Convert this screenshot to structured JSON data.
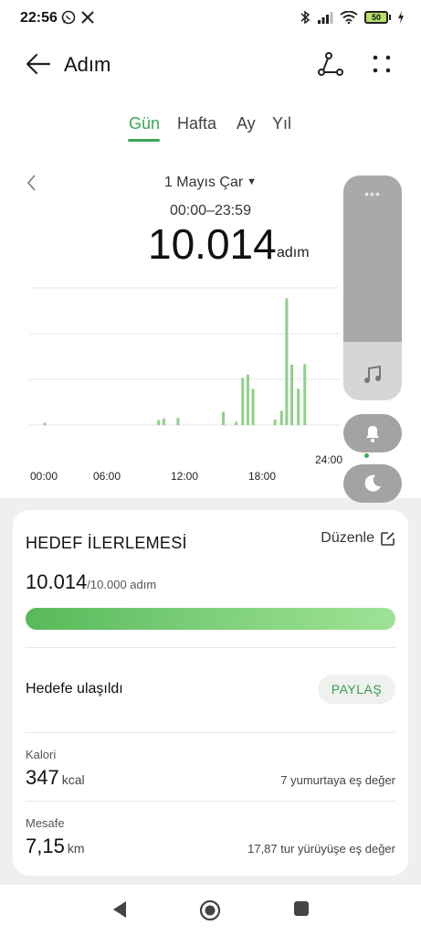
{
  "status_bar": {
    "time": "22:56",
    "battery": "50"
  },
  "app_bar": {
    "title": "Adım"
  },
  "tabs": [
    {
      "label": "Gün",
      "active": true
    },
    {
      "label": "Hafta",
      "active": false
    },
    {
      "label": "Ay",
      "active": false
    },
    {
      "label": "Yıl",
      "active": false
    }
  ],
  "day": {
    "date": "1 Mayıs Çar",
    "range": "00:00–23:59",
    "value": "10.014",
    "unit": "adım"
  },
  "chart_data": {
    "type": "bar",
    "x_ticks": [
      "00:00",
      "06:00",
      "12:00",
      "18:00",
      "24:00"
    ],
    "x_range_hours": [
      0,
      24
    ],
    "bars": [
      {
        "hour": 1.2,
        "value": 40
      },
      {
        "hour": 10.0,
        "value": 90
      },
      {
        "hour": 10.4,
        "value": 120
      },
      {
        "hour": 11.5,
        "value": 130
      },
      {
        "hour": 15.0,
        "value": 240
      },
      {
        "hour": 16.0,
        "value": 60
      },
      {
        "hour": 16.5,
        "value": 860
      },
      {
        "hour": 16.9,
        "value": 920
      },
      {
        "hour": 17.3,
        "value": 660
      },
      {
        "hour": 19.0,
        "value": 100
      },
      {
        "hour": 19.5,
        "value": 260
      },
      {
        "hour": 19.9,
        "value": 2310
      },
      {
        "hour": 20.3,
        "value": 1100
      },
      {
        "hour": 20.8,
        "value": 660
      },
      {
        "hour": 21.3,
        "value": 1110
      }
    ],
    "ylim": [
      0,
      2500
    ],
    "grid": true,
    "color": "#8fcf8a"
  },
  "goal_card": {
    "title": "HEDEF İLERLEMESİ",
    "edit_label": "Düzenle",
    "progress_value": "10.014",
    "progress_target": "/10.000 adım",
    "progress_fraction": 1.0,
    "reached_label": "Hedefe ulaşıldı",
    "share_label": "PAYLAŞ",
    "calories": {
      "label": "Kalori",
      "value": "347",
      "unit": "kcal",
      "equivalent": "7 yumurtaya eş değer"
    },
    "distance": {
      "label": "Mesafe",
      "value": "7,15",
      "unit": "km",
      "equivalent": "17,87 tur yürüyüşe eş değer"
    }
  },
  "colors": {
    "accent": "#3aa655",
    "bar": "#8fcf8a"
  }
}
